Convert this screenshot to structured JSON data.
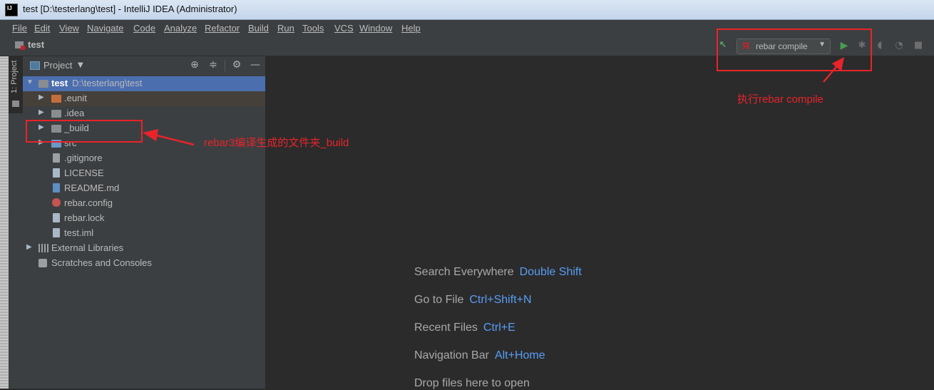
{
  "window": {
    "title": "test [D:\\testerlang\\test] - IntelliJ IDEA (Administrator)"
  },
  "menu": [
    {
      "label": "File"
    },
    {
      "label": "Edit"
    },
    {
      "label": "View"
    },
    {
      "label": "Navigate"
    },
    {
      "label": "Code"
    },
    {
      "label": "Analyze"
    },
    {
      "label": "Refactor"
    },
    {
      "label": "Build"
    },
    {
      "label": "Run"
    },
    {
      "label": "Tools"
    },
    {
      "label": "VCS"
    },
    {
      "label": "Window"
    },
    {
      "label": "Help"
    }
  ],
  "navbar": {
    "project_name": "test"
  },
  "toolbar": {
    "run_config_label": "rebar compile",
    "run_config_icon": "Я"
  },
  "tool_window": {
    "tab_label": "1: Project"
  },
  "project_panel": {
    "view_label": "Project",
    "tree": {
      "root_name": "test",
      "root_path": "D:\\testerlang\\test",
      "items": [
        {
          "label": ".eunit"
        },
        {
          "label": ".idea"
        },
        {
          "label": "_build"
        },
        {
          "label": "src"
        },
        {
          "label": ".gitignore"
        },
        {
          "label": "LICENSE"
        },
        {
          "label": "README.md"
        },
        {
          "label": "rebar.config"
        },
        {
          "label": "rebar.lock"
        },
        {
          "label": "test.iml"
        },
        {
          "label": "External Libraries"
        },
        {
          "label": "Scratches and Consoles"
        }
      ]
    }
  },
  "editor_hints": [
    {
      "text": "Search Everywhere",
      "key": "Double Shift"
    },
    {
      "text": "Go to File",
      "key": "Ctrl+Shift+N"
    },
    {
      "text": "Recent Files",
      "key": "Ctrl+E"
    },
    {
      "text": "Navigation Bar",
      "key": "Alt+Home"
    },
    {
      "text": "Drop files here to open",
      "key": ""
    }
  ],
  "annotations": {
    "build_folder_note": "rebar3编译生成的文件夹_build",
    "compile_note": "执行rebar compile"
  },
  "colors": {
    "annotation_red": "#e8242a",
    "selection_blue": "#4b6eaf",
    "hint_key_blue": "#589df6",
    "run_green": "#499c54"
  }
}
